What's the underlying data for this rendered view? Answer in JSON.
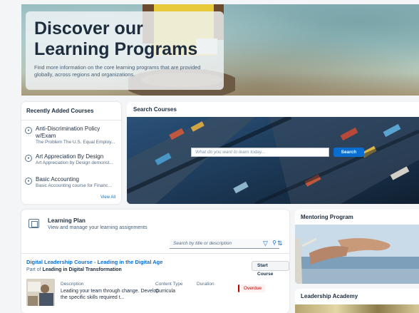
{
  "hero": {
    "title": "Discover our Learning Programs",
    "subtitle": "Find more information on the core learning programs that are provided globally, across regions and organizations."
  },
  "recent": {
    "header": "Recently Added Courses",
    "items": [
      {
        "title": "Anti-Discrimination Policy w/Exam",
        "desc": "The Problem The U.S. Equal Employ..."
      },
      {
        "title": "Art Appreciation By Design",
        "desc": "Art Appreciation by Design demonst..."
      },
      {
        "title": "Basic Accounting",
        "desc": "Basic Accounting course for Financ..."
      }
    ],
    "view_all": "View All"
  },
  "search": {
    "header": "Search Courses",
    "placeholder": "What do you want to learn today...",
    "button": "Search"
  },
  "plan": {
    "title": "Learning Plan",
    "subtitle": "View and manage your learning assignments",
    "search_placeholder": "Search by title or description",
    "course_title": "Digital Leadership Course - Leading in the Digital Age",
    "part_of_label": "Part of",
    "part_of_value": "Leading in Digital Transformation",
    "start_button": "Start Course",
    "desc_label": "Description",
    "desc_value": "Leading your team through change. Develop the specific skills required t...",
    "type_label": "Content Type",
    "type_value": "Curricula",
    "duration_label": "Duration",
    "status": "Overdue"
  },
  "mentor": {
    "header": "Mentoring Program"
  },
  "academy": {
    "header": "Leadership Academy"
  }
}
